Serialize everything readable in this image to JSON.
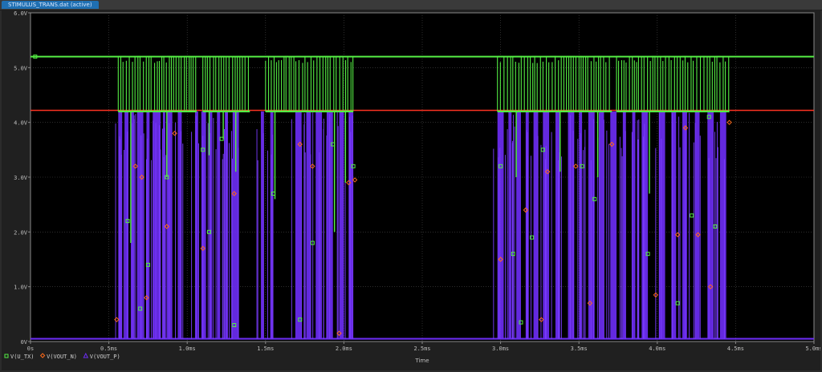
{
  "window": {
    "tab_title": "STIMULUS_TRANS.dat (active)"
  },
  "chart_data": {
    "type": "line",
    "xlabel": "Time",
    "ylabel": "",
    "xlim": [
      0,
      5.0
    ],
    "ylim": [
      0,
      6.0
    ],
    "grid": true,
    "x_ticks": [
      "0s",
      "0.5ms",
      "1.0ms",
      "1.5ms",
      "2.0ms",
      "2.5ms",
      "3.0ms",
      "3.5ms",
      "4.0ms",
      "4.5ms",
      "5.0ms"
    ],
    "y_ticks": [
      "0V",
      "1.0V",
      "2.0V",
      "3.0V",
      "4.0V",
      "5.0V",
      "6.0V"
    ],
    "legend_placement": "bottom-left",
    "colors": {
      "tx": "#55ee44",
      "voutn": "#ff3322",
      "voutp": "#6a2cf0",
      "grid": "#4a4a4a",
      "axis": "#8a8a8a"
    },
    "series": [
      {
        "name": "V(U_TX)",
        "marker": "square",
        "baseline": 5.2,
        "low_level": 4.2,
        "bursts": [
          [
            0.56,
            1.06
          ],
          [
            1.1,
            1.4
          ],
          [
            1.5,
            2.06
          ],
          [
            2.98,
            3.71
          ],
          [
            3.74,
            4.46
          ]
        ],
        "deep_drops": [
          [
            0.64,
            1.8
          ],
          [
            0.87,
            3.0
          ],
          [
            1.14,
            3.4
          ],
          [
            1.23,
            3.7
          ],
          [
            1.31,
            3.1
          ],
          [
            1.56,
            2.6
          ],
          [
            1.73,
            4.2
          ],
          [
            1.94,
            2.0
          ],
          [
            2.01,
            2.9
          ],
          [
            3.1,
            3.0
          ],
          [
            3.38,
            3.1
          ],
          [
            3.62,
            3.0
          ],
          [
            3.95,
            2.7
          ]
        ]
      },
      {
        "name": "V(VOUT_N)",
        "marker": "diamond",
        "level": 4.22
      },
      {
        "name": "V(VOUT_P)",
        "marker": "triangle",
        "low": 0.05,
        "high": 4.2,
        "pulses": [
          [
            0.56,
            0.585
          ],
          [
            0.6,
            0.625
          ],
          [
            0.64,
            0.66
          ],
          [
            0.68,
            0.72
          ],
          [
            0.74,
            0.76
          ],
          [
            0.78,
            0.83
          ],
          [
            0.845,
            0.86
          ],
          [
            0.87,
            0.905
          ],
          [
            0.94,
            0.965
          ],
          [
            1.05,
            1.07
          ],
          [
            1.09,
            1.12
          ],
          [
            1.14,
            1.16
          ],
          [
            1.19,
            1.21
          ],
          [
            1.24,
            1.26
          ],
          [
            1.29,
            1.33
          ],
          [
            1.47,
            1.49
          ],
          [
            1.53,
            1.55
          ],
          [
            1.69,
            1.73
          ],
          [
            1.76,
            1.79
          ],
          [
            1.82,
            1.86
          ],
          [
            1.89,
            1.93
          ],
          [
            1.97,
            2.0
          ],
          [
            2.03,
            2.06
          ],
          [
            2.98,
            3.02
          ],
          [
            3.05,
            3.07
          ],
          [
            3.1,
            3.13
          ],
          [
            3.16,
            3.18
          ],
          [
            3.21,
            3.24
          ],
          [
            3.27,
            3.31
          ],
          [
            3.35,
            3.38
          ],
          [
            3.43,
            3.47
          ],
          [
            3.5,
            3.52
          ],
          [
            3.56,
            3.6
          ],
          [
            3.63,
            3.66
          ],
          [
            3.7,
            3.74
          ],
          [
            3.78,
            3.8
          ],
          [
            3.84,
            3.86
          ],
          [
            3.9,
            3.94
          ],
          [
            4.01,
            4.05
          ],
          [
            4.09,
            4.12
          ],
          [
            4.16,
            4.19
          ],
          [
            4.24,
            4.27
          ],
          [
            4.32,
            4.36
          ],
          [
            4.4,
            4.44
          ]
        ]
      }
    ]
  }
}
